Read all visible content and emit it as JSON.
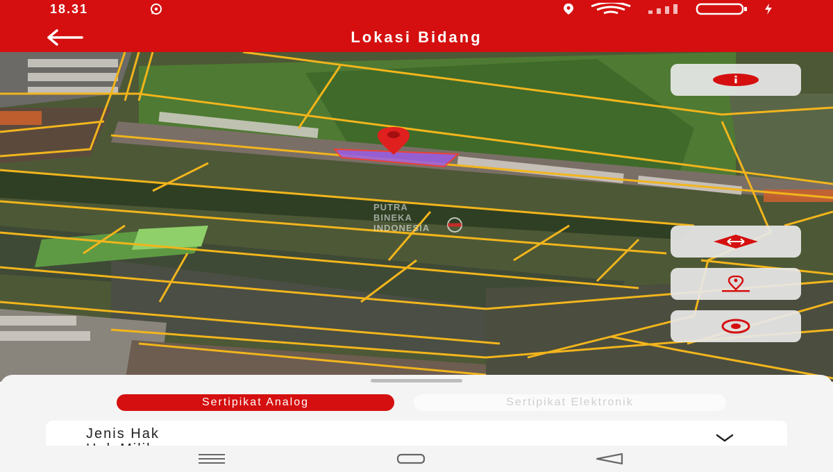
{
  "status_bar": {
    "time": "18.31",
    "icons": [
      "whatsapp-icon",
      "location-icon",
      "wifi-icon",
      "signal-icon",
      "battery-icon",
      "charging-icon"
    ]
  },
  "app_bar": {
    "title": "Lokasi Bidang",
    "back_icon": "arrow-left-icon"
  },
  "map": {
    "watermark": [
      "PUTRA",
      "BINEKA",
      "INDONESIA"
    ],
    "marker_icon": "map-pin-icon",
    "parcel_highlight_color": "#9b5de5",
    "parcel_line_color": "#f2b51c",
    "buttons": [
      {
        "name": "info",
        "icon": "info-icon"
      },
      {
        "name": "measure",
        "icon": "ruler-arrows-icon"
      },
      {
        "name": "locate-parcel",
        "icon": "location-pin-icon"
      },
      {
        "name": "my-location",
        "icon": "target-icon"
      }
    ]
  },
  "sheet": {
    "tabs": [
      {
        "label": "Sertipikat Analog",
        "active": true
      },
      {
        "label": "Sertipikat Elektronik",
        "active": false
      }
    ],
    "field_label": "Jenis Hak",
    "field_value": "Hak Milik",
    "expand_icon": "chevron-down-icon"
  },
  "nav_bar": {
    "icons": [
      "menu-icon",
      "home-icon",
      "back-triangle-icon"
    ]
  },
  "colors": {
    "primary": "#d50f0f",
    "sheet_background": "#f4f4f4"
  }
}
